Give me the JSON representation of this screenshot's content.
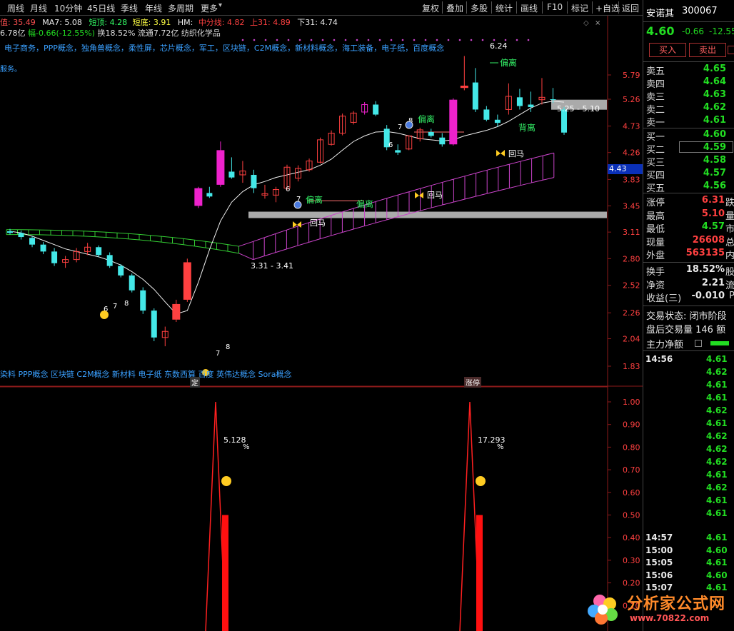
{
  "toolbar": {
    "periods": [
      "周线",
      "月线",
      "10分钟",
      "45日线",
      "季线",
      "年线",
      "多周期",
      "更多"
    ],
    "functions": [
      "复权",
      "叠加",
      "多股",
      "统计",
      "画线",
      "F10",
      "标记",
      "+自选",
      "返回"
    ]
  },
  "info1": {
    "cut": "值:",
    "cut_val": "35.49",
    "ma7": "MA7: 5.08",
    "dinge": "短顶: 4.28",
    "didi": "短底: 3.91",
    "hm": "HM:",
    "zhongfen": "中分线: 4.82",
    "shang31": "上31: 4.89",
    "xia31": "下31: 4.74"
  },
  "info2": {
    "a": "6.78亿",
    "b": "幅-0.66(-12.55%)",
    "c": "换18.52%",
    "d": "流通7.72亿",
    "e": "纺织化学品"
  },
  "concepts": "电子商务，PPP概念，独角兽概念，柔性屏，芯片概念，军工，区块链，C2M概念，新材料概念，海工装备，电子纸，百度概念",
  "service": "服务。",
  "concepts2": "染料 PPP概念 区块链 C2M概念 新材料 电子纸 东数西算 百度 英伟达概念 Sora概念",
  "main_axis": [
    "5.79",
    "5.26",
    "4.73",
    "4.26",
    "3.83",
    "3.45",
    "3.11",
    "2.80",
    "2.52",
    "2.26",
    "2.04",
    "1.83"
  ],
  "sub_axis": [
    "1.00",
    "0.90",
    "0.80",
    "0.70",
    "0.60",
    "0.50",
    "0.40",
    "0.30",
    "0.20",
    "0.10"
  ],
  "current_price_box": "4.43",
  "markers": {
    "zhangting": "涨停",
    "ding": "定"
  },
  "annotations": {
    "piancha": "偏离",
    "beili": "背离",
    "huima": "回马",
    "n6": "6",
    "n7": "7",
    "n8": "8",
    "high": "6.24",
    "range1": "5.25 - 5.10",
    "range2": "3.31 - 3.41",
    "pct1": "5.128",
    "pct2": "17.293",
    "pctsign": "%"
  },
  "chart_data": {
    "type": "candlestick",
    "ohlc": [
      [
        3.12,
        3.15,
        3.08,
        3.1
      ],
      [
        3.1,
        3.13,
        3.02,
        3.05
      ],
      [
        3.04,
        3.06,
        2.93,
        2.96
      ],
      [
        2.96,
        2.99,
        2.85,
        2.88
      ],
      [
        2.88,
        2.92,
        2.72,
        2.75
      ],
      [
        2.76,
        2.83,
        2.7,
        2.79
      ],
      [
        2.79,
        2.92,
        2.76,
        2.88
      ],
      [
        2.88,
        2.98,
        2.84,
        2.93
      ],
      [
        2.93,
        2.95,
        2.82,
        2.84
      ],
      [
        2.84,
        2.87,
        2.7,
        2.72
      ],
      [
        2.72,
        2.74,
        2.6,
        2.62
      ],
      [
        2.62,
        2.64,
        2.45,
        2.47
      ],
      [
        2.47,
        2.5,
        2.25,
        2.28
      ],
      [
        2.28,
        2.3,
        2.02,
        2.05
      ],
      [
        2.05,
        2.14,
        1.98,
        2.1
      ],
      [
        2.2,
        2.38,
        2.18,
        2.34
      ],
      [
        2.38,
        2.8,
        2.36,
        2.76
      ],
      [
        3.45,
        3.72,
        3.42,
        3.7
      ],
      [
        3.63,
        3.72,
        3.56,
        3.58
      ],
      [
        3.75,
        4.45,
        3.72,
        4.3
      ],
      [
        3.95,
        4.18,
        3.84,
        3.86
      ],
      [
        3.9,
        4.12,
        3.78,
        3.96
      ],
      [
        3.9,
        3.98,
        3.63,
        3.7
      ],
      [
        3.6,
        3.75,
        3.55,
        3.62
      ],
      [
        3.6,
        3.72,
        3.5,
        3.68
      ],
      [
        3.7,
        4.06,
        3.67,
        4.02
      ],
      [
        3.85,
        4.05,
        3.8,
        4.0
      ],
      [
        3.98,
        4.16,
        3.95,
        4.12
      ],
      [
        4.1,
        4.52,
        4.08,
        4.48
      ],
      [
        4.4,
        4.65,
        4.38,
        4.6
      ],
      [
        4.6,
        4.97,
        4.56,
        4.92
      ],
      [
        4.8,
        5.02,
        4.76,
        4.98
      ],
      [
        5.0,
        5.2,
        4.95,
        5.15
      ],
      [
        5.15,
        5.22,
        4.92,
        4.95
      ],
      [
        4.68,
        4.75,
        4.3,
        4.35
      ],
      [
        4.3,
        4.4,
        4.22,
        4.26
      ],
      [
        4.32,
        4.56,
        4.3,
        4.55
      ],
      [
        4.5,
        4.7,
        4.45,
        4.66
      ],
      [
        4.62,
        4.68,
        4.52,
        4.55
      ],
      [
        4.52,
        4.6,
        4.36,
        4.4
      ],
      [
        4.4,
        5.28,
        4.38,
        5.25
      ],
      [
        5.5,
        6.24,
        5.45,
        5.55
      ],
      [
        5.62,
        5.95,
        5.0,
        5.05
      ],
      [
        5.05,
        5.12,
        4.82,
        4.85
      ],
      [
        4.85,
        4.95,
        4.72,
        4.79
      ],
      [
        5.05,
        5.6,
        4.95,
        5.32
      ],
      [
        5.3,
        5.48,
        5.05,
        5.12
      ],
      [
        5.15,
        5.42,
        5.0,
        5.1
      ],
      [
        5.25,
        5.72,
        5.15,
        5.3
      ],
      [
        5.26,
        5.5,
        5.18,
        5.25
      ],
      [
        5.05,
        5.1,
        4.57,
        4.61
      ]
    ],
    "ma_line": [
      3.12,
      3.1,
      3.06,
      3.01,
      2.96,
      2.91,
      2.88,
      2.85,
      2.82,
      2.78,
      2.73,
      2.66,
      2.58,
      2.48,
      2.36,
      2.25,
      2.28,
      2.55,
      2.9,
      3.25,
      3.5,
      3.65,
      3.75,
      3.8,
      3.86,
      3.9,
      3.94,
      3.98,
      4.05,
      4.15,
      4.3,
      4.45,
      4.55,
      4.62,
      4.63,
      4.6,
      4.55,
      4.5,
      4.48,
      4.46,
      4.48,
      4.55,
      4.6,
      4.65,
      4.72,
      4.82,
      4.95,
      5.08,
      5.18,
      5.22,
      5.2
    ],
    "gray_bands": [
      {
        "label": "5.25 - 5.10",
        "value": 5.18
      },
      {
        "label": "3.31 - 3.41",
        "value": 3.36
      }
    ],
    "sub_spikes": [
      {
        "x_index": 15,
        "value": 1.0,
        "label": "5.128%"
      },
      {
        "x_index": 40,
        "value": 1.0,
        "label": "17.293%"
      }
    ],
    "sub_bars": [
      {
        "x_index": 16,
        "value": 0.5
      },
      {
        "x_index": 41,
        "value": 0.5
      }
    ]
  },
  "right_panel": {
    "name": "安诺其",
    "code": "300067",
    "price": "4.60",
    "change": "-0.66",
    "pct": "-12.55",
    "buy_btn": "买入",
    "sell_btn": "卖出",
    "asks": [
      {
        "l": "卖五",
        "p": "4.65"
      },
      {
        "l": "卖四",
        "p": "4.64"
      },
      {
        "l": "卖三",
        "p": "4.63"
      },
      {
        "l": "卖二",
        "p": "4.62"
      },
      {
        "l": "卖一",
        "p": "4.61"
      }
    ],
    "bids": [
      {
        "l": "买一",
        "p": "4.60"
      },
      {
        "l": "买二",
        "p": "4.59"
      },
      {
        "l": "买三",
        "p": "4.58"
      },
      {
        "l": "买四",
        "p": "4.57"
      },
      {
        "l": "买五",
        "p": "4.56"
      }
    ],
    "stats": [
      {
        "l": "涨停",
        "v": "6.31",
        "s": "跌",
        "c": "#ff4040"
      },
      {
        "l": "最高",
        "v": "5.10",
        "s": "量",
        "c": "#ff4040"
      },
      {
        "l": "最低",
        "v": "4.57",
        "s": "市",
        "c": "#22dd22"
      },
      {
        "l": "现量",
        "v": "26608",
        "s": "总",
        "c": "#ff4040"
      },
      {
        "l": "外盘",
        "v": "563135",
        "s": "内",
        "c": "#ff4040"
      }
    ],
    "stats2": [
      {
        "l": "换手",
        "v": "18.52%",
        "s": "股",
        "c": "#e8e8e8"
      },
      {
        "l": "净资",
        "v": "2.21",
        "s": "流",
        "c": "#e8e8e8"
      },
      {
        "l": "收益(三)",
        "v": "-0.010",
        "s": "P",
        "c": "#e8e8e8"
      }
    ],
    "status": "交易状态: 闭市阶段",
    "after": "盘后交易量 146 额",
    "mainflow": "主力净额",
    "trades1_time": "14:56",
    "trades1": [
      "4.61",
      "4.62",
      "4.61",
      "4.61",
      "4.62",
      "4.61",
      "4.62",
      "4.62",
      "4.62",
      "4.61",
      "4.62",
      "4.61",
      "4.61"
    ],
    "trades2": [
      {
        "t": "14:57",
        "p": "4.61"
      },
      {
        "t": "15:00",
        "p": "4.60"
      },
      {
        "t": "15:05",
        "p": "4.61"
      },
      {
        "t": "15:06",
        "p": "4.60"
      },
      {
        "t": "15:07",
        "p": "4.61"
      }
    ]
  },
  "watermark": {
    "title": "分析家公式网",
    "url": "www.70822.com"
  }
}
